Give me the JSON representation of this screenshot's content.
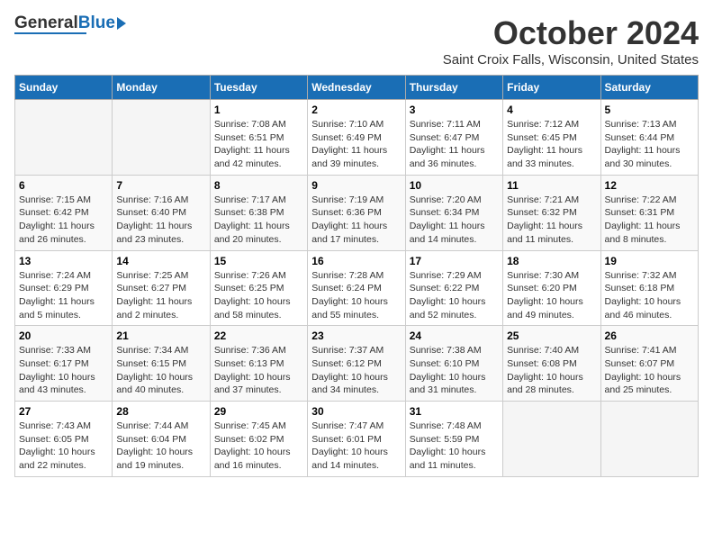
{
  "logo": {
    "general": "General",
    "blue": "Blue"
  },
  "title": "October 2024",
  "subtitle": "Saint Croix Falls, Wisconsin, United States",
  "weekdays": [
    "Sunday",
    "Monday",
    "Tuesday",
    "Wednesday",
    "Thursday",
    "Friday",
    "Saturday"
  ],
  "weeks": [
    [
      {
        "day": "",
        "empty": true
      },
      {
        "day": "",
        "empty": true
      },
      {
        "day": "1",
        "sunrise": "Sunrise: 7:08 AM",
        "sunset": "Sunset: 6:51 PM",
        "daylight": "Daylight: 11 hours and 42 minutes."
      },
      {
        "day": "2",
        "sunrise": "Sunrise: 7:10 AM",
        "sunset": "Sunset: 6:49 PM",
        "daylight": "Daylight: 11 hours and 39 minutes."
      },
      {
        "day": "3",
        "sunrise": "Sunrise: 7:11 AM",
        "sunset": "Sunset: 6:47 PM",
        "daylight": "Daylight: 11 hours and 36 minutes."
      },
      {
        "day": "4",
        "sunrise": "Sunrise: 7:12 AM",
        "sunset": "Sunset: 6:45 PM",
        "daylight": "Daylight: 11 hours and 33 minutes."
      },
      {
        "day": "5",
        "sunrise": "Sunrise: 7:13 AM",
        "sunset": "Sunset: 6:44 PM",
        "daylight": "Daylight: 11 hours and 30 minutes."
      }
    ],
    [
      {
        "day": "6",
        "sunrise": "Sunrise: 7:15 AM",
        "sunset": "Sunset: 6:42 PM",
        "daylight": "Daylight: 11 hours and 26 minutes."
      },
      {
        "day": "7",
        "sunrise": "Sunrise: 7:16 AM",
        "sunset": "Sunset: 6:40 PM",
        "daylight": "Daylight: 11 hours and 23 minutes."
      },
      {
        "day": "8",
        "sunrise": "Sunrise: 7:17 AM",
        "sunset": "Sunset: 6:38 PM",
        "daylight": "Daylight: 11 hours and 20 minutes."
      },
      {
        "day": "9",
        "sunrise": "Sunrise: 7:19 AM",
        "sunset": "Sunset: 6:36 PM",
        "daylight": "Daylight: 11 hours and 17 minutes."
      },
      {
        "day": "10",
        "sunrise": "Sunrise: 7:20 AM",
        "sunset": "Sunset: 6:34 PM",
        "daylight": "Daylight: 11 hours and 14 minutes."
      },
      {
        "day": "11",
        "sunrise": "Sunrise: 7:21 AM",
        "sunset": "Sunset: 6:32 PM",
        "daylight": "Daylight: 11 hours and 11 minutes."
      },
      {
        "day": "12",
        "sunrise": "Sunrise: 7:22 AM",
        "sunset": "Sunset: 6:31 PM",
        "daylight": "Daylight: 11 hours and 8 minutes."
      }
    ],
    [
      {
        "day": "13",
        "sunrise": "Sunrise: 7:24 AM",
        "sunset": "Sunset: 6:29 PM",
        "daylight": "Daylight: 11 hours and 5 minutes."
      },
      {
        "day": "14",
        "sunrise": "Sunrise: 7:25 AM",
        "sunset": "Sunset: 6:27 PM",
        "daylight": "Daylight: 11 hours and 2 minutes."
      },
      {
        "day": "15",
        "sunrise": "Sunrise: 7:26 AM",
        "sunset": "Sunset: 6:25 PM",
        "daylight": "Daylight: 10 hours and 58 minutes."
      },
      {
        "day": "16",
        "sunrise": "Sunrise: 7:28 AM",
        "sunset": "Sunset: 6:24 PM",
        "daylight": "Daylight: 10 hours and 55 minutes."
      },
      {
        "day": "17",
        "sunrise": "Sunrise: 7:29 AM",
        "sunset": "Sunset: 6:22 PM",
        "daylight": "Daylight: 10 hours and 52 minutes."
      },
      {
        "day": "18",
        "sunrise": "Sunrise: 7:30 AM",
        "sunset": "Sunset: 6:20 PM",
        "daylight": "Daylight: 10 hours and 49 minutes."
      },
      {
        "day": "19",
        "sunrise": "Sunrise: 7:32 AM",
        "sunset": "Sunset: 6:18 PM",
        "daylight": "Daylight: 10 hours and 46 minutes."
      }
    ],
    [
      {
        "day": "20",
        "sunrise": "Sunrise: 7:33 AM",
        "sunset": "Sunset: 6:17 PM",
        "daylight": "Daylight: 10 hours and 43 minutes."
      },
      {
        "day": "21",
        "sunrise": "Sunrise: 7:34 AM",
        "sunset": "Sunset: 6:15 PM",
        "daylight": "Daylight: 10 hours and 40 minutes."
      },
      {
        "day": "22",
        "sunrise": "Sunrise: 7:36 AM",
        "sunset": "Sunset: 6:13 PM",
        "daylight": "Daylight: 10 hours and 37 minutes."
      },
      {
        "day": "23",
        "sunrise": "Sunrise: 7:37 AM",
        "sunset": "Sunset: 6:12 PM",
        "daylight": "Daylight: 10 hours and 34 minutes."
      },
      {
        "day": "24",
        "sunrise": "Sunrise: 7:38 AM",
        "sunset": "Sunset: 6:10 PM",
        "daylight": "Daylight: 10 hours and 31 minutes."
      },
      {
        "day": "25",
        "sunrise": "Sunrise: 7:40 AM",
        "sunset": "Sunset: 6:08 PM",
        "daylight": "Daylight: 10 hours and 28 minutes."
      },
      {
        "day": "26",
        "sunrise": "Sunrise: 7:41 AM",
        "sunset": "Sunset: 6:07 PM",
        "daylight": "Daylight: 10 hours and 25 minutes."
      }
    ],
    [
      {
        "day": "27",
        "sunrise": "Sunrise: 7:43 AM",
        "sunset": "Sunset: 6:05 PM",
        "daylight": "Daylight: 10 hours and 22 minutes."
      },
      {
        "day": "28",
        "sunrise": "Sunrise: 7:44 AM",
        "sunset": "Sunset: 6:04 PM",
        "daylight": "Daylight: 10 hours and 19 minutes."
      },
      {
        "day": "29",
        "sunrise": "Sunrise: 7:45 AM",
        "sunset": "Sunset: 6:02 PM",
        "daylight": "Daylight: 10 hours and 16 minutes."
      },
      {
        "day": "30",
        "sunrise": "Sunrise: 7:47 AM",
        "sunset": "Sunset: 6:01 PM",
        "daylight": "Daylight: 10 hours and 14 minutes."
      },
      {
        "day": "31",
        "sunrise": "Sunrise: 7:48 AM",
        "sunset": "Sunset: 5:59 PM",
        "daylight": "Daylight: 10 hours and 11 minutes."
      },
      {
        "day": "",
        "empty": true
      },
      {
        "day": "",
        "empty": true
      }
    ]
  ]
}
